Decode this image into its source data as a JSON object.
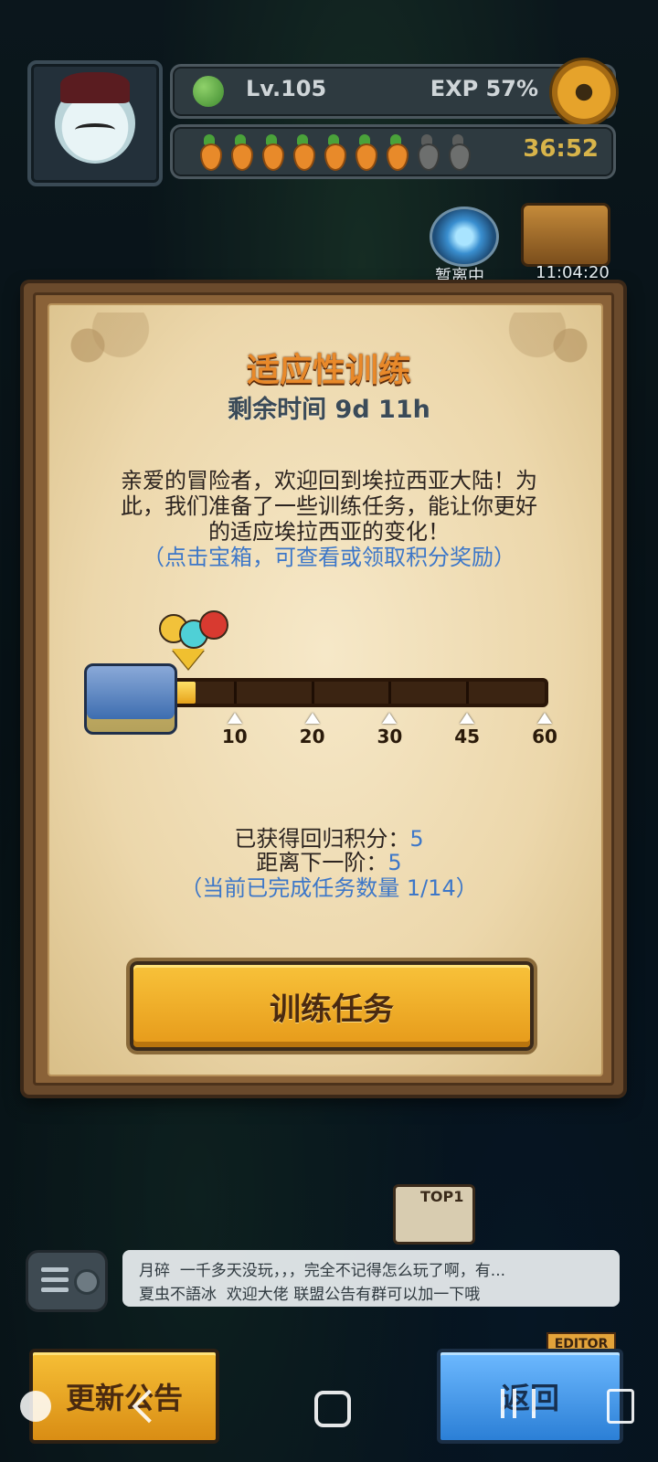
{
  "hud": {
    "level": "Lv.105",
    "exp": "EXP 57%",
    "energy_total": 9,
    "energy_filled": 7,
    "energy_timer": "36:52",
    "away_label": "暂离中",
    "chest_time": "11:04:20"
  },
  "dialog": {
    "title": "适应性训练",
    "remaining": "剩余时间 9d 11h",
    "description_lines": [
      "亲爱的冒险者，欢迎回到埃拉西亚大陆！为",
      "此，我们准备了一些训练任务，能让你更好",
      "的适应埃拉西亚的变化！"
    ],
    "hint": "（点击宝箱，可查看或领取积分奖励）",
    "progress": {
      "current": 5,
      "max": 60,
      "milestones": [
        "10",
        "20",
        "30",
        "45",
        "60"
      ]
    },
    "earned_label": "已获得回归积分：",
    "earned_value": "5",
    "next_label": "距离下一阶：",
    "next_value": "5",
    "tasks_done": "（当前已完成任务数量 1/14）",
    "task_button": "训练任务"
  },
  "island_badge": "TOP1",
  "chat": {
    "messages": [
      {
        "user": "月碎",
        "text": "一千多天没玩，，，完全不记得怎么玩了啊，有..."
      },
      {
        "user": "夏虫不語冰",
        "text": "欢迎大佬 联盟公告有群可以加一下哦"
      }
    ]
  },
  "editor_tag": "EDITOR",
  "bottom": {
    "notice_button": "更新公告",
    "back_button": "返回"
  },
  "colors": {
    "title_orange": "#e8892a",
    "hint_blue": "#3d77c8",
    "button_gold": "#f8c23a",
    "button_blue": "#2b7fd6"
  }
}
